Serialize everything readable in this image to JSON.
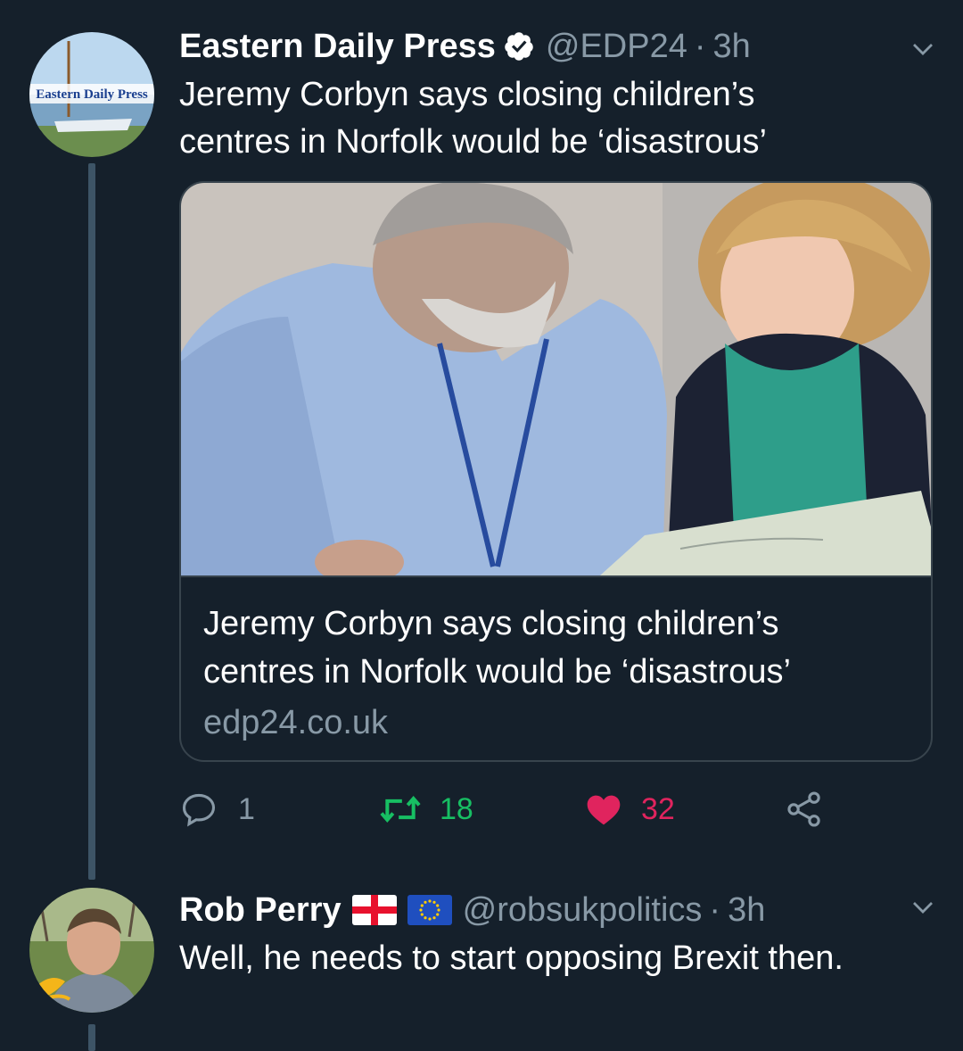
{
  "tweets": [
    {
      "author": "Eastern Daily Press",
      "verified": true,
      "handle": "@EDP24",
      "time": "3h",
      "avatar_text": "Eastern Daily Press",
      "text_line1": "Jeremy Corbyn says closing children’s",
      "text_line2": "centres in Norfolk would be ‘disastrous’",
      "card": {
        "title_line1": "Jeremy Corbyn says closing children’s",
        "title_line2": "centres in Norfolk would be ‘disastrous’",
        "domain": "edp24.co.uk"
      },
      "actions": {
        "replies": "1",
        "retweets": "18",
        "likes": "32"
      }
    },
    {
      "author": "Rob Perry",
      "flags": [
        "england-flag-icon",
        "eu-flag-icon"
      ],
      "handle": "@robsukpolitics",
      "time": "3h",
      "text": "Well, he needs to start opposing Brexit then."
    }
  ],
  "colors": {
    "background": "#15202b",
    "secondary_text": "#8899a6",
    "retweet_green": "#17bf63",
    "like_pink": "#e0245e",
    "border": "#38444d"
  }
}
